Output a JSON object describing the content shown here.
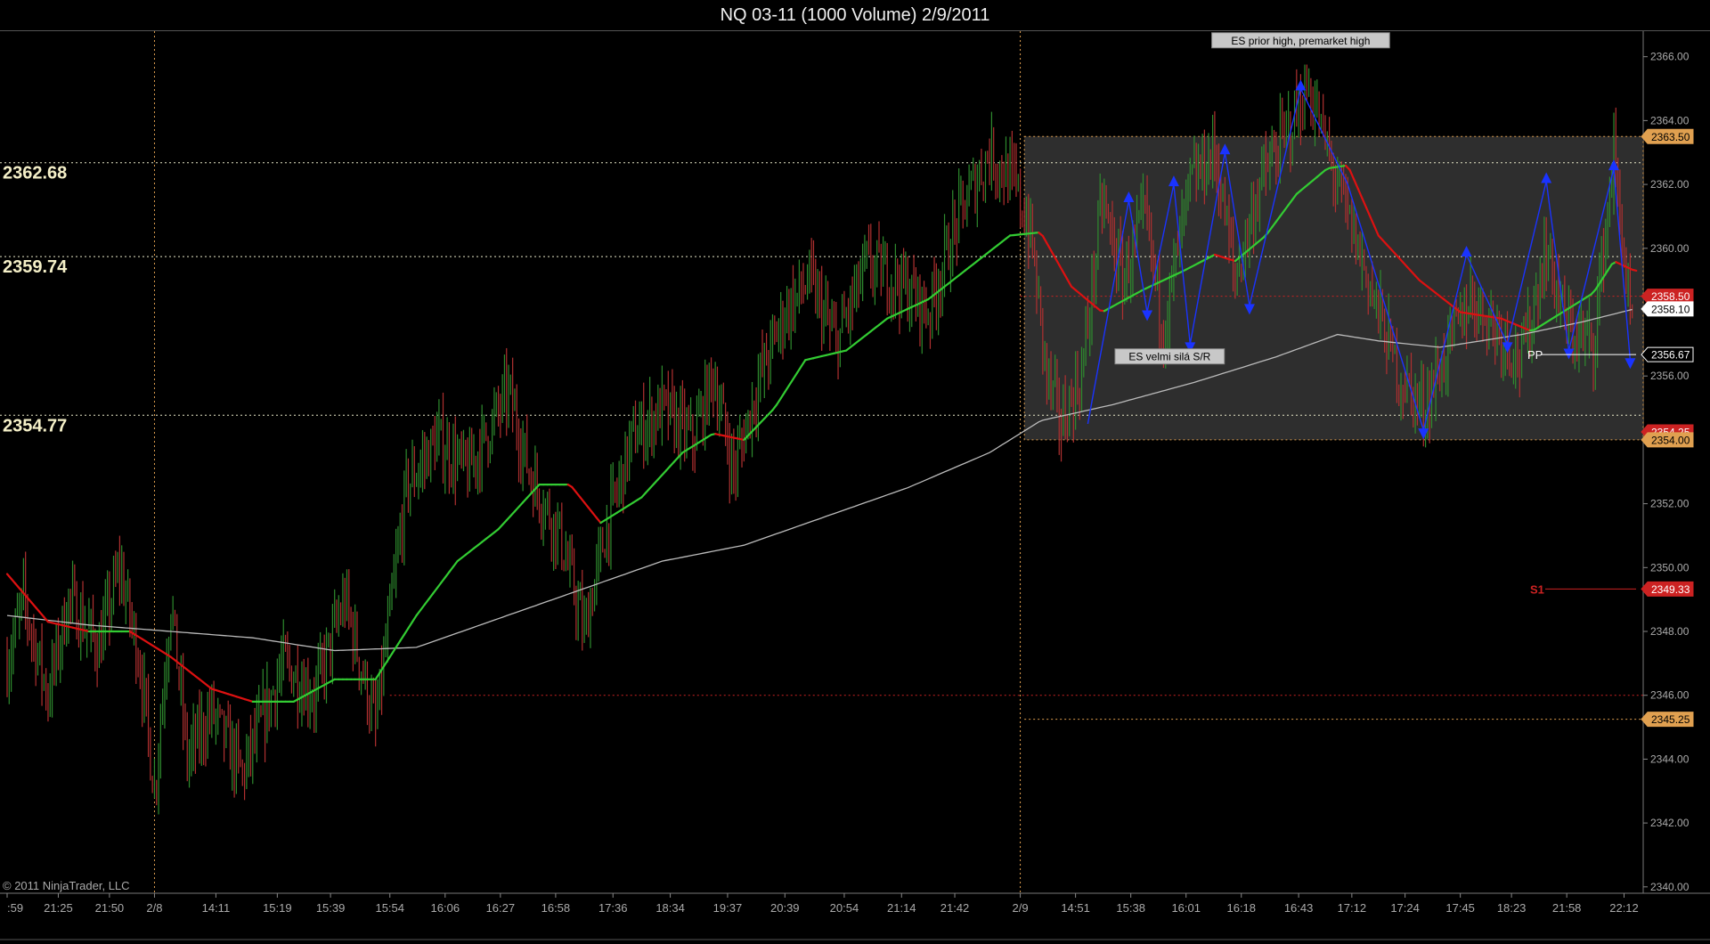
{
  "window": {
    "title": "NQ 03-11 (1000 Volume)  2/9/2011"
  },
  "footer": {
    "copyright": "© 2011 NinjaTrader, LLC"
  },
  "colors": {
    "background": "#000000",
    "ma_rising": "#33cc33",
    "ma_falling": "#dd1111",
    "ma_long": "#bbbbbb",
    "up_bar": "#2e8b2e",
    "down_bar": "#b03030",
    "zigzag": "#1a33ff",
    "level_gold": "#e0a050",
    "level_red": "#cc2222",
    "level_white": "#ffffff"
  },
  "chart_data": {
    "type": "line",
    "instrument": "NQ 03-11",
    "bar_period": "1000 Volume",
    "ylim": [
      2339.8,
      2366.8
    ],
    "y_ticks": [
      2340,
      2342,
      2344,
      2346,
      2348,
      2350,
      2352,
      2354,
      2356,
      2358,
      2360,
      2362,
      2364,
      2366
    ],
    "y_tick_labels": [
      "2340.00",
      "2342.00",
      "2344.00",
      "2346.00",
      "2348.00",
      "2350.00",
      "2352.00",
      "2354.00",
      "2356.00",
      "2358.00",
      "2360.00",
      "2362.00",
      "2364.00",
      "2366.00"
    ],
    "x_tick_labels": [
      ":59",
      "21:25",
      "21:50",
      "2/8",
      "14:11",
      "15:19",
      "15:39",
      "15:54",
      "16:06",
      "16:27",
      "16:58",
      "17:36",
      "18:34",
      "19:37",
      "20:39",
      "20:54",
      "21:14",
      "21:42",
      "2/9",
      "14:51",
      "15:38",
      "16:01",
      "16:18",
      "16:43",
      "17:12",
      "17:24",
      "17:45",
      "18:23",
      "21:58",
      "22:12"
    ],
    "x_tick_index": [
      0,
      25,
      50,
      72,
      102,
      132,
      158,
      187,
      214,
      241,
      268,
      296,
      324,
      352,
      380,
      409,
      437,
      463,
      495,
      522,
      549,
      576,
      603,
      631,
      657,
      683,
      710,
      735,
      762,
      790
    ],
    "session_breaks": [
      72,
      495
    ],
    "bars_count": 795,
    "price_path": [
      [
        0,
        2347.0
      ],
      [
        8,
        2349.0
      ],
      [
        20,
        2346.0
      ],
      [
        30,
        2349.0
      ],
      [
        45,
        2347.5
      ],
      [
        55,
        2350.0
      ],
      [
        65,
        2347.0
      ],
      [
        72,
        2343.0
      ],
      [
        80,
        2349.0
      ],
      [
        88,
        2344.0
      ],
      [
        100,
        2345.5
      ],
      [
        115,
        2343.5
      ],
      [
        135,
        2347.0
      ],
      [
        150,
        2346.0
      ],
      [
        165,
        2349.0
      ],
      [
        180,
        2345.0
      ],
      [
        195,
        2352.5
      ],
      [
        210,
        2354.0
      ],
      [
        225,
        2353.0
      ],
      [
        245,
        2355.5
      ],
      [
        255,
        2353.0
      ],
      [
        270,
        2351.0
      ],
      [
        282,
        2348.0
      ],
      [
        292,
        2351.0
      ],
      [
        305,
        2354.0
      ],
      [
        320,
        2355.0
      ],
      [
        335,
        2354.0
      ],
      [
        345,
        2356.0
      ],
      [
        355,
        2353.0
      ],
      [
        368,
        2356.0
      ],
      [
        380,
        2358.0
      ],
      [
        392,
        2359.0
      ],
      [
        405,
        2357.0
      ],
      [
        420,
        2359.5
      ],
      [
        435,
        2359.0
      ],
      [
        450,
        2358.0
      ],
      [
        465,
        2361.0
      ],
      [
        480,
        2363.0
      ],
      [
        492,
        2362.0
      ],
      [
        500,
        2360.5
      ],
      [
        508,
        2356.0
      ],
      [
        515,
        2354.5
      ],
      [
        525,
        2356.0
      ],
      [
        535,
        2361.5
      ],
      [
        545,
        2359.0
      ],
      [
        556,
        2361.0
      ],
      [
        565,
        2357.5
      ],
      [
        578,
        2362.0
      ],
      [
        590,
        2363.0
      ],
      [
        600,
        2359.0
      ],
      [
        612,
        2362.0
      ],
      [
        624,
        2363.5
      ],
      [
        636,
        2365.0
      ],
      [
        650,
        2362.0
      ],
      [
        665,
        2359.0
      ],
      [
        680,
        2356.0
      ],
      [
        692,
        2355.0
      ],
      [
        705,
        2357.0
      ],
      [
        715,
        2358.5
      ],
      [
        728,
        2357.5
      ],
      [
        740,
        2356.5
      ],
      [
        752,
        2360.0
      ],
      [
        762,
        2357.5
      ],
      [
        775,
        2357.0
      ],
      [
        785,
        2363.0
      ],
      [
        795,
        2356.5
      ]
    ],
    "zigzag": [
      [
        528,
        2354.5
      ],
      [
        548,
        2361.5
      ],
      [
        557,
        2358.0
      ],
      [
        570,
        2362.0
      ],
      [
        578,
        2357.0
      ],
      [
        595,
        2363.0
      ],
      [
        607,
        2358.2
      ],
      [
        632,
        2365.0
      ],
      [
        655,
        2362.0
      ],
      [
        692,
        2354.3
      ],
      [
        713,
        2359.8
      ],
      [
        733,
        2357.0
      ],
      [
        752,
        2362.1
      ],
      [
        763,
        2356.8
      ],
      [
        785,
        2362.5
      ],
      [
        793,
        2356.5
      ]
    ],
    "zigzag_up_markers": [
      548,
      570,
      595,
      632,
      713,
      752,
      785
    ],
    "zigzag_down_markers": [
      557,
      578,
      607,
      692,
      733,
      763,
      793
    ],
    "ma_short_path": [
      [
        0,
        2349.8
      ],
      [
        20,
        2348.3
      ],
      [
        40,
        2348.0
      ],
      [
        60,
        2348.0
      ],
      [
        80,
        2347.2
      ],
      [
        100,
        2346.2
      ],
      [
        120,
        2345.8
      ],
      [
        140,
        2345.8
      ],
      [
        160,
        2346.5
      ],
      [
        180,
        2346.5
      ],
      [
        200,
        2348.5
      ],
      [
        220,
        2350.2
      ],
      [
        240,
        2351.2
      ],
      [
        260,
        2352.6
      ],
      [
        275,
        2352.6
      ],
      [
        290,
        2351.4
      ],
      [
        310,
        2352.2
      ],
      [
        330,
        2353.6
      ],
      [
        345,
        2354.2
      ],
      [
        360,
        2354.0
      ],
      [
        375,
        2355.0
      ],
      [
        390,
        2356.5
      ],
      [
        410,
        2356.8
      ],
      [
        430,
        2357.8
      ],
      [
        450,
        2358.4
      ],
      [
        470,
        2359.4
      ],
      [
        490,
        2360.4
      ],
      [
        505,
        2360.5
      ],
      [
        520,
        2358.8
      ],
      [
        535,
        2358.0
      ],
      [
        555,
        2358.7
      ],
      [
        575,
        2359.3
      ],
      [
        590,
        2359.8
      ],
      [
        600,
        2359.6
      ],
      [
        615,
        2360.4
      ],
      [
        630,
        2361.7
      ],
      [
        645,
        2362.5
      ],
      [
        655,
        2362.6
      ],
      [
        670,
        2360.4
      ],
      [
        690,
        2359.0
      ],
      [
        710,
        2358.0
      ],
      [
        730,
        2357.8
      ],
      [
        745,
        2357.4
      ],
      [
        760,
        2358.0
      ],
      [
        775,
        2358.6
      ],
      [
        785,
        2359.6
      ],
      [
        795,
        2359.3
      ]
    ],
    "ma_long_path": [
      [
        0,
        2348.5
      ],
      [
        40,
        2348.2
      ],
      [
        80,
        2348.0
      ],
      [
        120,
        2347.8
      ],
      [
        160,
        2347.4
      ],
      [
        200,
        2347.5
      ],
      [
        240,
        2348.4
      ],
      [
        280,
        2349.3
      ],
      [
        320,
        2350.2
      ],
      [
        360,
        2350.7
      ],
      [
        400,
        2351.6
      ],
      [
        440,
        2352.5
      ],
      [
        480,
        2353.6
      ],
      [
        505,
        2354.6
      ],
      [
        540,
        2355.1
      ],
      [
        580,
        2355.8
      ],
      [
        620,
        2356.6
      ],
      [
        650,
        2357.3
      ],
      [
        670,
        2357.1
      ],
      [
        700,
        2356.9
      ],
      [
        740,
        2357.3
      ],
      [
        770,
        2357.7
      ],
      [
        795,
        2358.1
      ]
    ],
    "horizontal_levels": [
      {
        "value": 2362.68,
        "label": "2362.68",
        "style": "dotted-white",
        "from": 0,
        "to": 795
      },
      {
        "value": 2359.74,
        "label": "2359.74",
        "style": "dotted-white",
        "from": 0,
        "to": 795
      },
      {
        "value": 2354.77,
        "label": "2354.77",
        "style": "dotted-white",
        "from": 0,
        "to": 795
      },
      {
        "value": 2358.5,
        "style": "dotted-red",
        "from": 495,
        "to": 795
      },
      {
        "value": 2346.0,
        "style": "dotted-red",
        "from": 187,
        "to": 495
      },
      {
        "value": 2345.25,
        "style": "dotted-gold",
        "from": 497,
        "to": 795
      }
    ],
    "zone": {
      "top": 2363.5,
      "bottom": 2354.0,
      "from": 497,
      "to": 795
    },
    "pivots": [
      {
        "name": "PP",
        "value": 2356.67
      },
      {
        "name": "S1",
        "value": 2349.33
      }
    ],
    "annotations": [
      {
        "text": "ES prior high, premarket high",
        "x": 632,
        "y": 2366.5
      },
      {
        "text": "ES velmi silá S/R",
        "x": 568,
        "y": 2356.6
      }
    ],
    "price_tags": [
      {
        "text": "2363.50",
        "value": 2363.5,
        "bg": "#e0a050",
        "fg": "#000000"
      },
      {
        "text": "2358.50",
        "value": 2358.5,
        "bg": "#cc2222",
        "fg": "#ffffff"
      },
      {
        "text": "2358.10",
        "value": 2358.1,
        "bg": "#ffffff",
        "fg": "#000000"
      },
      {
        "text": "2356.67",
        "value": 2356.67,
        "bg": "#000000",
        "fg": "#ffffff"
      },
      {
        "text": "2354.25",
        "value": 2354.25,
        "bg": "#cc2222",
        "fg": "#ffffff"
      },
      {
        "text": "2354.00",
        "value": 2354.0,
        "bg": "#e0a050",
        "fg": "#000000"
      },
      {
        "text": "2349.33",
        "value": 2349.33,
        "bg": "#cc2222",
        "fg": "#ffffff"
      },
      {
        "text": "2345.25",
        "value": 2345.25,
        "bg": "#e0a050",
        "fg": "#000000"
      }
    ]
  }
}
